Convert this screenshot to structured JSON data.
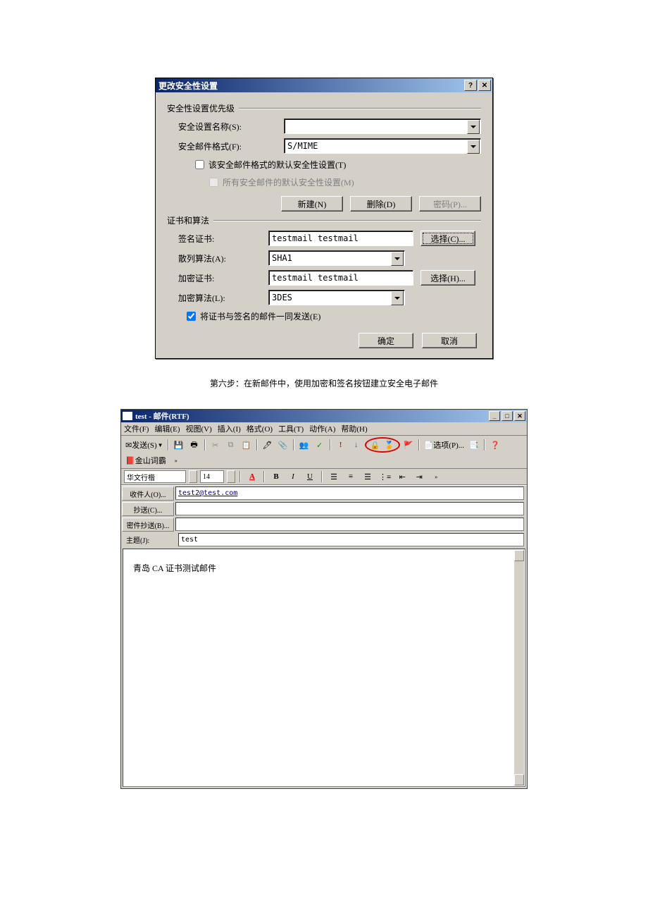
{
  "dialog": {
    "title": "更改安全性设置",
    "section1": {
      "label": "安全性设置优先级",
      "name_label": "安全设置名称(S):",
      "name_value": "",
      "format_label": "安全邮件格式(F):",
      "format_value": "S/MIME",
      "check1": "该安全邮件格式的默认安全性设置(T)",
      "check2": "所有安全邮件的默认安全性设置(M)",
      "btn_new": "新建(N)",
      "btn_delete": "删除(D)",
      "btn_password": "密码(P)..."
    },
    "section2": {
      "label": "证书和算法",
      "sign_cert_label": "签名证书:",
      "sign_cert_value": "testmail testmail",
      "sign_cert_btn": "选择(C)...",
      "hash_label": "散列算法(A):",
      "hash_value": "SHA1",
      "enc_cert_label": "加密证书:",
      "enc_cert_value": "testmail testmail",
      "enc_cert_btn": "选择(H)...",
      "enc_alg_label": "加密算法(L):",
      "enc_alg_value": "3DES",
      "check_send": "将证书与签名的邮件一同发送(E)"
    },
    "ok": "确定",
    "cancel": "取消"
  },
  "caption": "第六步：在新邮件中，使用加密和签名按钮建立安全电子邮件",
  "mail": {
    "title": "test - 邮件(RTF)",
    "menu": {
      "file": "文件(F)",
      "edit": "编辑(E)",
      "view": "视图(V)",
      "insert": "插入(I)",
      "format": "格式(O)",
      "tools": "工具(T)",
      "actions": "动作(A)",
      "help": "帮助(H)"
    },
    "toolbar": {
      "send": "发送(S)",
      "options": "选项(P)...",
      "lookup": "金山词霸"
    },
    "format_bar": {
      "font": "华文行楷",
      "size": "14"
    },
    "fields": {
      "to_btn": "收件人(O)...",
      "to_value": "test2@test.com",
      "cc_btn": "抄送(C)...",
      "cc_value": "",
      "bcc_btn": "密件抄送(B)...",
      "bcc_value": "",
      "subject_lbl": "主题(J):",
      "subject_value": "test"
    },
    "body": "青岛 CA 证书测试邮件"
  }
}
